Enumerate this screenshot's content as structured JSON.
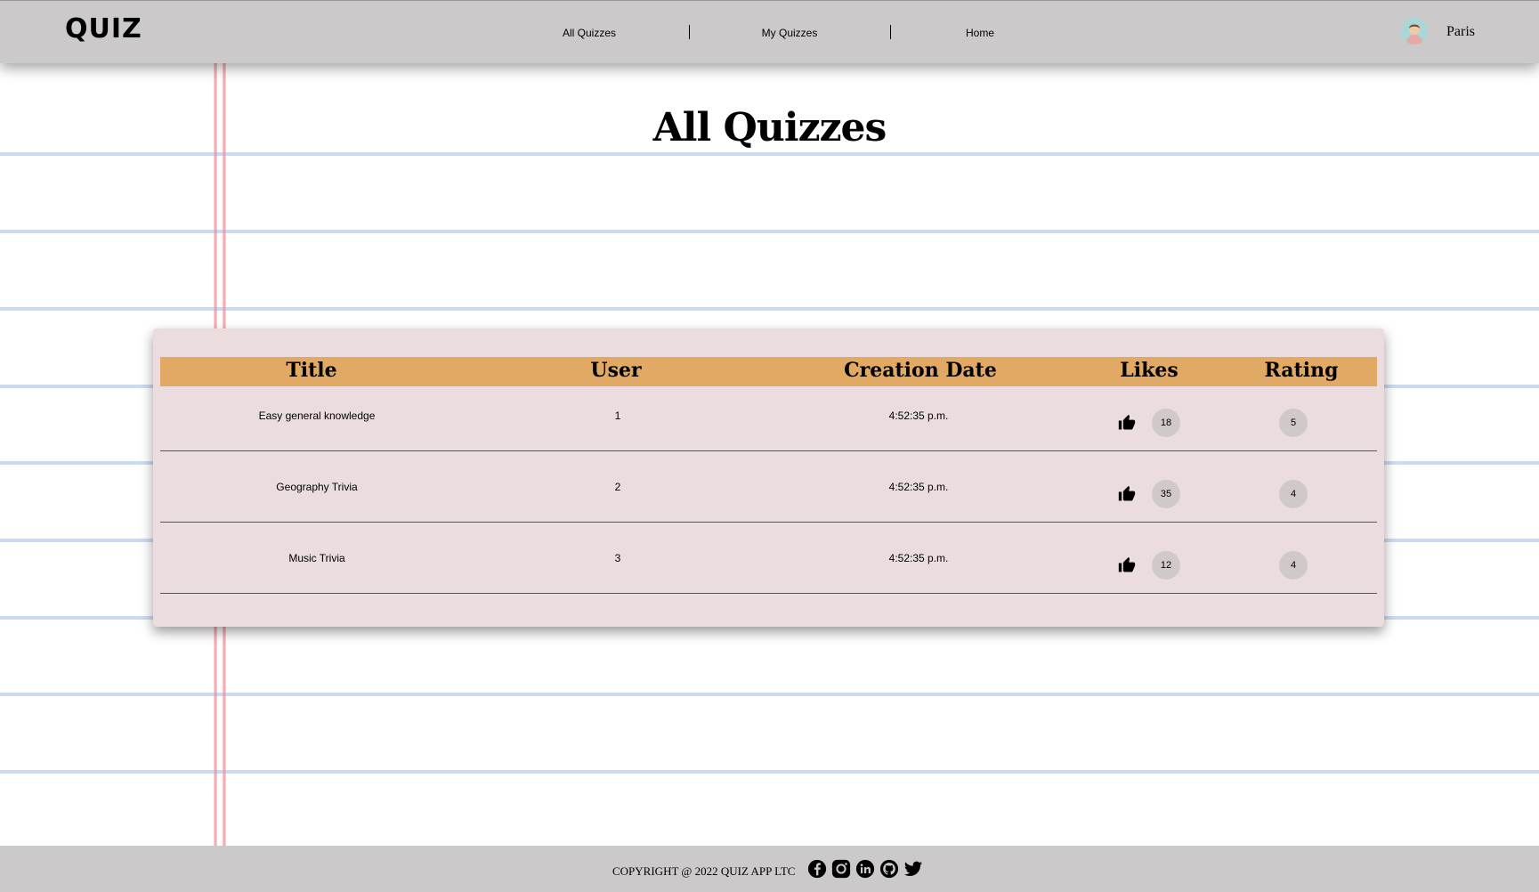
{
  "header": {
    "logo": "QUIZ",
    "nav": [
      "All Quizzes",
      "My Quizzes",
      "Home"
    ],
    "user_name": "Paris"
  },
  "main": {
    "title": "All Quizzes",
    "table": {
      "columns": [
        "Title",
        "User",
        "Creation Date",
        "Likes",
        "Rating"
      ],
      "rows": [
        {
          "title": "Easy general knowledge",
          "user": "1",
          "date": "4:52:35 p.m.",
          "likes": "18",
          "rating": "5"
        },
        {
          "title": "Geography Trivia",
          "user": "2",
          "date": "4:52:35 p.m.",
          "likes": "35",
          "rating": "4"
        },
        {
          "title": "Music Trivia",
          "user": "3",
          "date": "4:52:35 p.m.",
          "likes": "12",
          "rating": "4"
        }
      ]
    }
  },
  "footer": {
    "copyright": "COPYRIGHT @ 2022 QUIZ APP LTC",
    "social_icons": [
      "facebook-icon",
      "instagram-icon",
      "linkedin-icon",
      "github-icon",
      "twitter-icon"
    ]
  },
  "colors": {
    "header_bg": "#cbc9c9",
    "table_bg": "#ebdcdd",
    "table_header_bg": "#e1a964",
    "badge_bg": "#cfc9c9"
  }
}
